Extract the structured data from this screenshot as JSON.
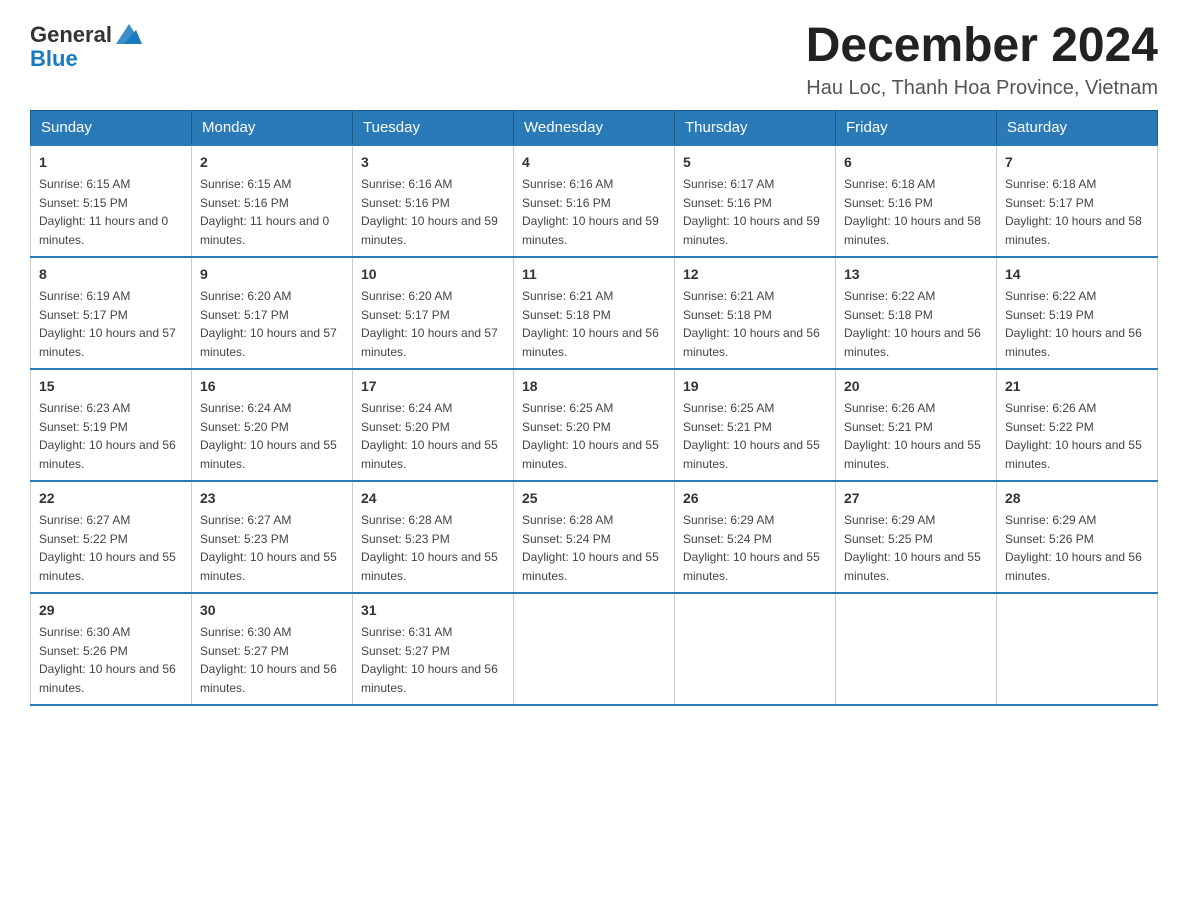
{
  "header": {
    "logo_general": "General",
    "logo_blue": "Blue",
    "month_title": "December 2024",
    "location": "Hau Loc, Thanh Hoa Province, Vietnam"
  },
  "weekdays": [
    "Sunday",
    "Monday",
    "Tuesday",
    "Wednesday",
    "Thursday",
    "Friday",
    "Saturday"
  ],
  "weeks": [
    [
      {
        "day": "1",
        "sunrise": "6:15 AM",
        "sunset": "5:15 PM",
        "daylight": "11 hours and 0 minutes."
      },
      {
        "day": "2",
        "sunrise": "6:15 AM",
        "sunset": "5:16 PM",
        "daylight": "11 hours and 0 minutes."
      },
      {
        "day": "3",
        "sunrise": "6:16 AM",
        "sunset": "5:16 PM",
        "daylight": "10 hours and 59 minutes."
      },
      {
        "day": "4",
        "sunrise": "6:16 AM",
        "sunset": "5:16 PM",
        "daylight": "10 hours and 59 minutes."
      },
      {
        "day": "5",
        "sunrise": "6:17 AM",
        "sunset": "5:16 PM",
        "daylight": "10 hours and 59 minutes."
      },
      {
        "day": "6",
        "sunrise": "6:18 AM",
        "sunset": "5:16 PM",
        "daylight": "10 hours and 58 minutes."
      },
      {
        "day": "7",
        "sunrise": "6:18 AM",
        "sunset": "5:17 PM",
        "daylight": "10 hours and 58 minutes."
      }
    ],
    [
      {
        "day": "8",
        "sunrise": "6:19 AM",
        "sunset": "5:17 PM",
        "daylight": "10 hours and 57 minutes."
      },
      {
        "day": "9",
        "sunrise": "6:20 AM",
        "sunset": "5:17 PM",
        "daylight": "10 hours and 57 minutes."
      },
      {
        "day": "10",
        "sunrise": "6:20 AM",
        "sunset": "5:17 PM",
        "daylight": "10 hours and 57 minutes."
      },
      {
        "day": "11",
        "sunrise": "6:21 AM",
        "sunset": "5:18 PM",
        "daylight": "10 hours and 56 minutes."
      },
      {
        "day": "12",
        "sunrise": "6:21 AM",
        "sunset": "5:18 PM",
        "daylight": "10 hours and 56 minutes."
      },
      {
        "day": "13",
        "sunrise": "6:22 AM",
        "sunset": "5:18 PM",
        "daylight": "10 hours and 56 minutes."
      },
      {
        "day": "14",
        "sunrise": "6:22 AM",
        "sunset": "5:19 PM",
        "daylight": "10 hours and 56 minutes."
      }
    ],
    [
      {
        "day": "15",
        "sunrise": "6:23 AM",
        "sunset": "5:19 PM",
        "daylight": "10 hours and 56 minutes."
      },
      {
        "day": "16",
        "sunrise": "6:24 AM",
        "sunset": "5:20 PM",
        "daylight": "10 hours and 55 minutes."
      },
      {
        "day": "17",
        "sunrise": "6:24 AM",
        "sunset": "5:20 PM",
        "daylight": "10 hours and 55 minutes."
      },
      {
        "day": "18",
        "sunrise": "6:25 AM",
        "sunset": "5:20 PM",
        "daylight": "10 hours and 55 minutes."
      },
      {
        "day": "19",
        "sunrise": "6:25 AM",
        "sunset": "5:21 PM",
        "daylight": "10 hours and 55 minutes."
      },
      {
        "day": "20",
        "sunrise": "6:26 AM",
        "sunset": "5:21 PM",
        "daylight": "10 hours and 55 minutes."
      },
      {
        "day": "21",
        "sunrise": "6:26 AM",
        "sunset": "5:22 PM",
        "daylight": "10 hours and 55 minutes."
      }
    ],
    [
      {
        "day": "22",
        "sunrise": "6:27 AM",
        "sunset": "5:22 PM",
        "daylight": "10 hours and 55 minutes."
      },
      {
        "day": "23",
        "sunrise": "6:27 AM",
        "sunset": "5:23 PM",
        "daylight": "10 hours and 55 minutes."
      },
      {
        "day": "24",
        "sunrise": "6:28 AM",
        "sunset": "5:23 PM",
        "daylight": "10 hours and 55 minutes."
      },
      {
        "day": "25",
        "sunrise": "6:28 AM",
        "sunset": "5:24 PM",
        "daylight": "10 hours and 55 minutes."
      },
      {
        "day": "26",
        "sunrise": "6:29 AM",
        "sunset": "5:24 PM",
        "daylight": "10 hours and 55 minutes."
      },
      {
        "day": "27",
        "sunrise": "6:29 AM",
        "sunset": "5:25 PM",
        "daylight": "10 hours and 55 minutes."
      },
      {
        "day": "28",
        "sunrise": "6:29 AM",
        "sunset": "5:26 PM",
        "daylight": "10 hours and 56 minutes."
      }
    ],
    [
      {
        "day": "29",
        "sunrise": "6:30 AM",
        "sunset": "5:26 PM",
        "daylight": "10 hours and 56 minutes."
      },
      {
        "day": "30",
        "sunrise": "6:30 AM",
        "sunset": "5:27 PM",
        "daylight": "10 hours and 56 minutes."
      },
      {
        "day": "31",
        "sunrise": "6:31 AM",
        "sunset": "5:27 PM",
        "daylight": "10 hours and 56 minutes."
      },
      null,
      null,
      null,
      null
    ]
  ],
  "labels": {
    "sunrise": "Sunrise:",
    "sunset": "Sunset:",
    "daylight": "Daylight:"
  }
}
